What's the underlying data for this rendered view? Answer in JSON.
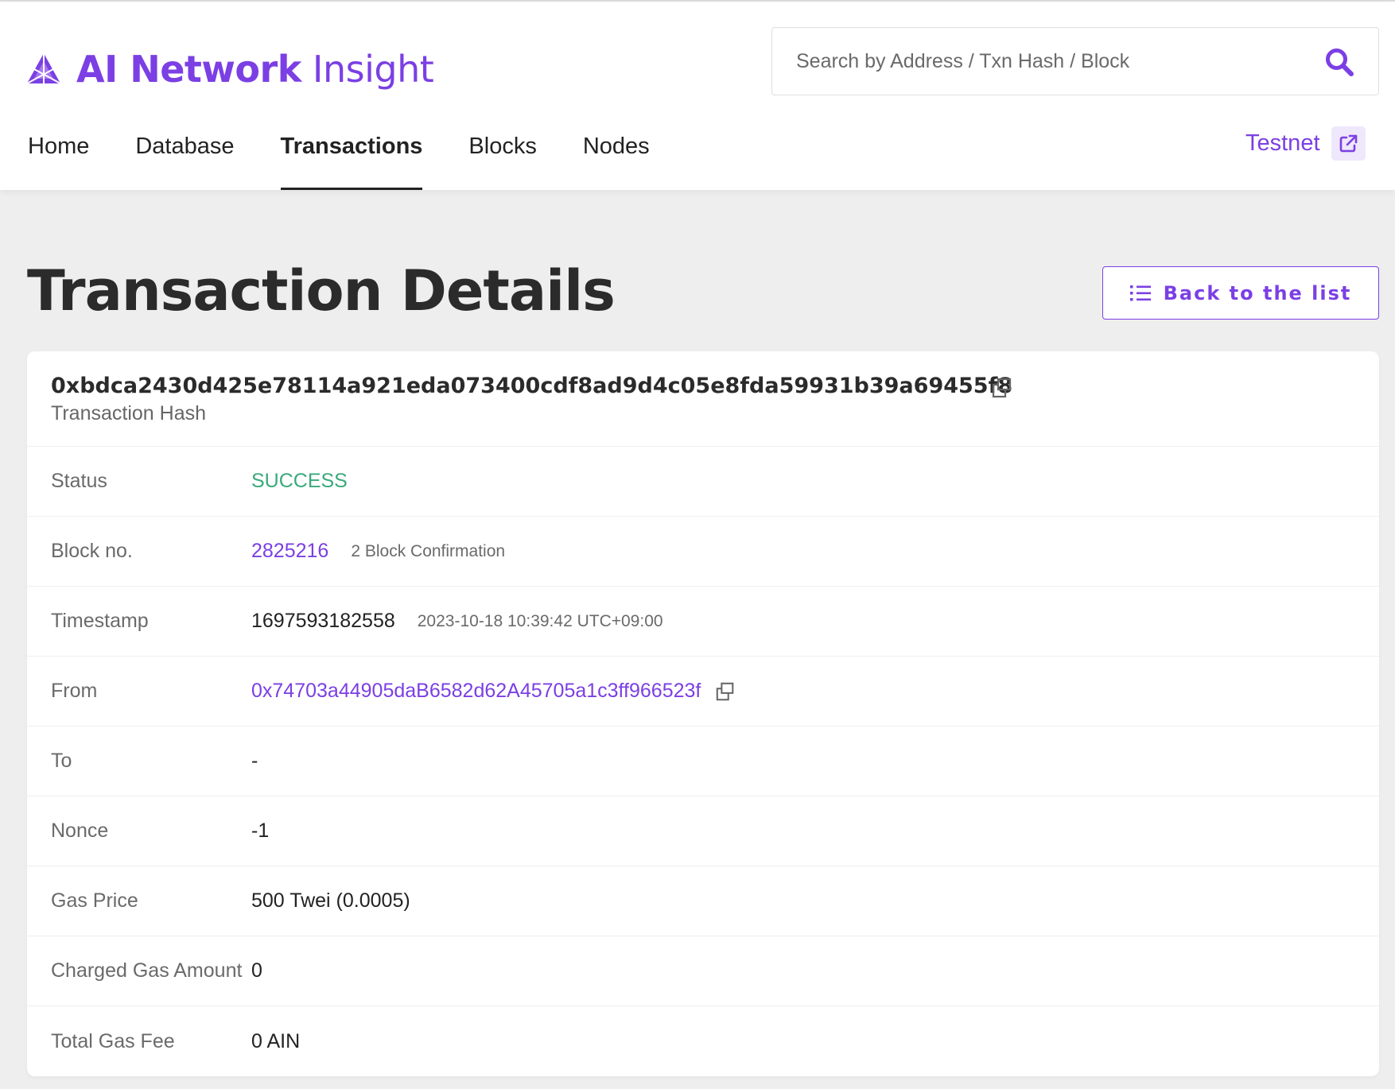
{
  "app": {
    "brand_bold": "AI Network",
    "brand_light": "Insight",
    "accent_color": "#7b3fe4",
    "success_color": "#3aaa7b"
  },
  "search": {
    "placeholder": "Search by Address / Txn Hash / Block",
    "value": "",
    "icon": "search-icon"
  },
  "nav": {
    "items": [
      {
        "label": "Home",
        "active": false
      },
      {
        "label": "Database",
        "active": false
      },
      {
        "label": "Transactions",
        "active": true
      },
      {
        "label": "Blocks",
        "active": false
      },
      {
        "label": "Nodes",
        "active": false
      }
    ],
    "network_label": "Testnet",
    "network_icon": "external-link-icon"
  },
  "page": {
    "title": "Transaction Details",
    "back_button_label": "Back to the list",
    "back_button_icon": "list-icon"
  },
  "transaction": {
    "hash": "0xbdca2430d425e78114a921eda073400cdf8ad9d4c05e8fda59931b39a69455f8",
    "hash_label": "Transaction Hash",
    "copy_icon": "copy-icon",
    "fields": {
      "status": {
        "label": "Status",
        "value": "SUCCESS"
      },
      "block": {
        "label": "Block no.",
        "value": "2825216",
        "sub": "2 Block Confirmation"
      },
      "timestamp": {
        "label": "Timestamp",
        "value": "1697593182558",
        "sub": "2023-10-18 10:39:42 UTC+09:00"
      },
      "from": {
        "label": "From",
        "value": "0x74703a44905daB6582d62A45705a1c3ff966523f"
      },
      "to": {
        "label": "To",
        "value": "-"
      },
      "nonce": {
        "label": "Nonce",
        "value": "-1"
      },
      "gas_price": {
        "label": "Gas Price",
        "value": "500 Twei (0.0005)"
      },
      "charged_gas": {
        "label": "Charged Gas Amount",
        "value": "0"
      },
      "total_gas_fee": {
        "label": "Total Gas Fee",
        "value": "0 AIN"
      }
    }
  }
}
